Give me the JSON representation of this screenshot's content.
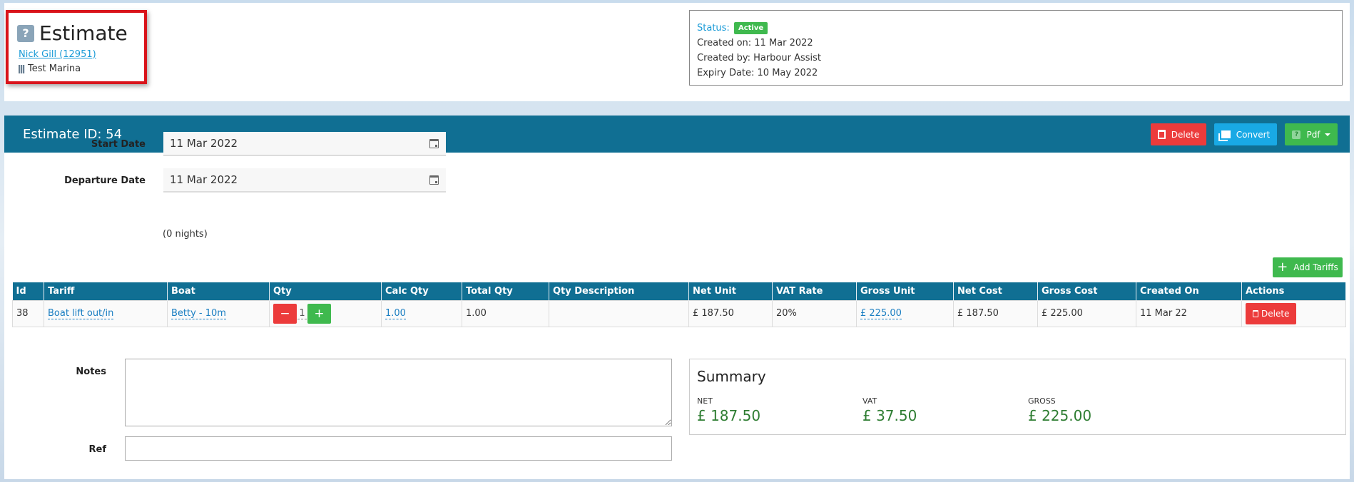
{
  "header": {
    "title": "Estimate",
    "help_icon": "?",
    "customer": "Nick Gill (12951)",
    "marina": "Test Marina"
  },
  "status_box": {
    "status_label": "Status:",
    "status_value": "Active",
    "created_on": "Created on: 11 Mar 2022",
    "created_by": "Created by: Harbour Assist",
    "expiry_date": "Expiry Date: 10 May 2022"
  },
  "panel": {
    "title": "Estimate ID: 54",
    "buttons": {
      "delete": "Delete",
      "convert": "Convert",
      "pdf": "Pdf"
    }
  },
  "form": {
    "start_date_label": "Start Date",
    "start_date": "11 Mar 2022",
    "departure_date_label": "Departure Date",
    "departure_date": "11 Mar 2022",
    "nights": "(0 nights)",
    "add_tariffs": "Add Tariffs"
  },
  "table": {
    "columns": [
      "Id",
      "Tariff",
      "Boat",
      "Qty",
      "Calc Qty",
      "Total Qty",
      "Qty Description",
      "Net Unit",
      "VAT Rate",
      "Gross Unit",
      "Net Cost",
      "Gross Cost",
      "Created On",
      "Actions"
    ],
    "rows": [
      {
        "id": "38",
        "tariff": "Boat lift out/in",
        "boat": "Betty - 10m",
        "qty": "1",
        "calc_qty": "1.00",
        "total_qty": "1.00",
        "qty_description": "",
        "net_unit": "£ 187.50",
        "vat_rate": "20%",
        "gross_unit": "£ 225.00",
        "net_cost": "£ 187.50",
        "gross_cost": "£ 225.00",
        "created_on": "11 Mar 22",
        "action": "Delete"
      }
    ]
  },
  "notes": {
    "label": "Notes",
    "value": ""
  },
  "ref": {
    "label": "Ref",
    "value": ""
  },
  "summary": {
    "title": "Summary",
    "net_label": "NET",
    "net_value": "£ 187.50",
    "vat_label": "VAT",
    "vat_value": "£ 37.50",
    "gross_label": "GROSS",
    "gross_value": "£ 225.00"
  },
  "colors": {
    "primary": "#106f93",
    "danger": "#ec3b3b",
    "info": "#19a9e5",
    "success": "#3fb94e",
    "money": "#2e7d32",
    "highlight_border": "#d9141b"
  }
}
